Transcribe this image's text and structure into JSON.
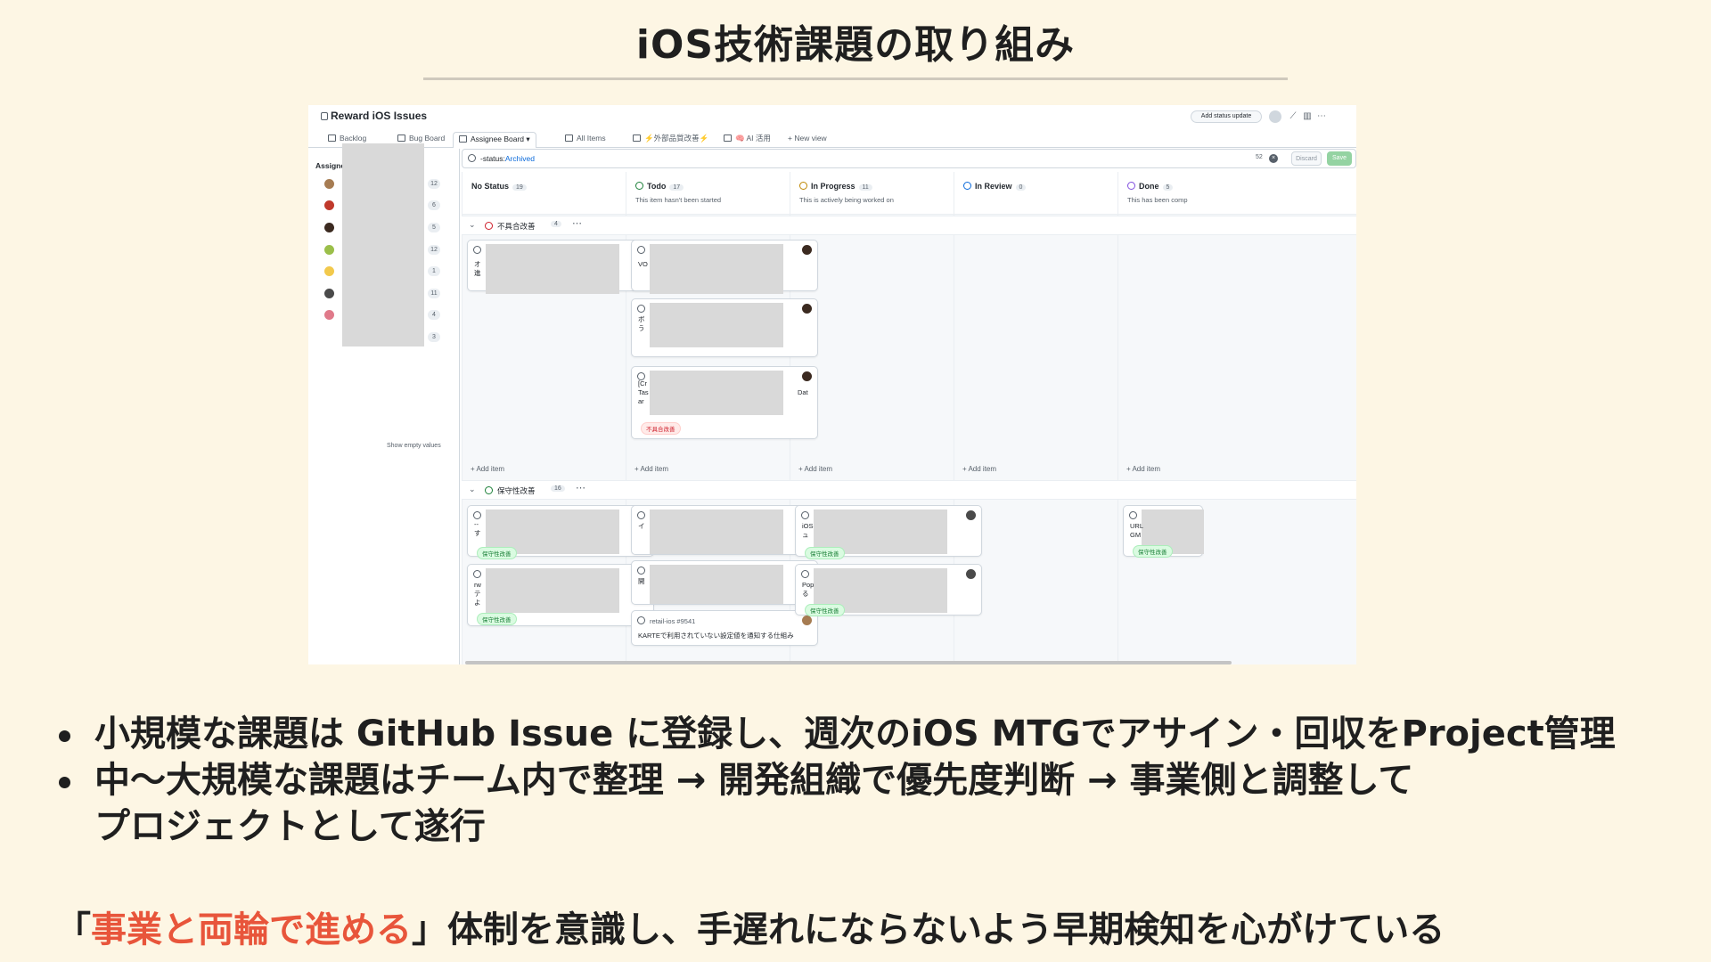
{
  "slide": {
    "title": "iOS技術課題の取り組み",
    "bullets": [
      "小規模な課題は GitHub Issue に登録し、週次のiOS MTGでアサイン・回収をProject管理",
      "中〜大規模な課題はチーム内で整理 → 開発組織で優先度判断 → 事業側と調整して",
      "プロジェクトとして遂行"
    ],
    "footer_open": "「",
    "footer_accent": "事業と両輪で進める",
    "footer_rest": "」体制を意識し、手遅れにならないよう早期検知を心がけている",
    "accent_color": "#e8553b"
  },
  "screenshot": {
    "project_title": "Reward iOS Issues",
    "add_status_label": "Add status update",
    "tabs": [
      {
        "label": "Backlog"
      },
      {
        "label": "Bug Board"
      },
      {
        "label": "Assignee Board"
      },
      {
        "label": "All Items"
      },
      {
        "label": "⚡外部品質改善⚡"
      },
      {
        "label": "🧠 AI 活用"
      },
      {
        "label": "+ New view"
      }
    ],
    "sidebar": {
      "header": "Assignees ▾",
      "counts": [
        "12",
        "6",
        "5",
        "12",
        "1",
        "11",
        "4",
        "3"
      ],
      "footer": "Show empty values"
    },
    "filter": {
      "prefix": "-status:",
      "value": "Archived",
      "count": "52",
      "discard": "Discard",
      "save": "Save"
    },
    "columns": [
      {
        "title": "No Status",
        "count": "19",
        "desc": ""
      },
      {
        "title": "Todo",
        "count": "17",
        "desc": "This item hasn't been started"
      },
      {
        "title": "In Progress",
        "count": "11",
        "desc": "This is actively being worked on"
      },
      {
        "title": "In Review",
        "count": "0",
        "desc": ""
      },
      {
        "title": "Done",
        "count": "5",
        "desc": "This has been comp"
      }
    ],
    "groups": [
      {
        "label": "不具合改善",
        "count": "4"
      },
      {
        "label": "保守性改善",
        "count": "16"
      }
    ],
    "labels": {
      "bug": "不具合改善",
      "maint": "保守性改善"
    },
    "add_item": "+ Add item",
    "peek": {
      "c1": "オ\n進",
      "c2": "VO",
      "c3": "ボ\nう",
      "c4": "[Cr\nTas\nar",
      "c4r": "Dat",
      "g2c1": "--\nす",
      "g2c2": "rw\nテ\nよ",
      "g2c3": "イ",
      "g2c4": "開",
      "g2c5": "iOS\nュ",
      "g2c6": "Pop\nる",
      "g2c7": "URL\nGM"
    },
    "visible_card": {
      "ref": "retail-ios #9541",
      "text": "KARTEで利用されていない設定値を通知する仕組み"
    }
  }
}
